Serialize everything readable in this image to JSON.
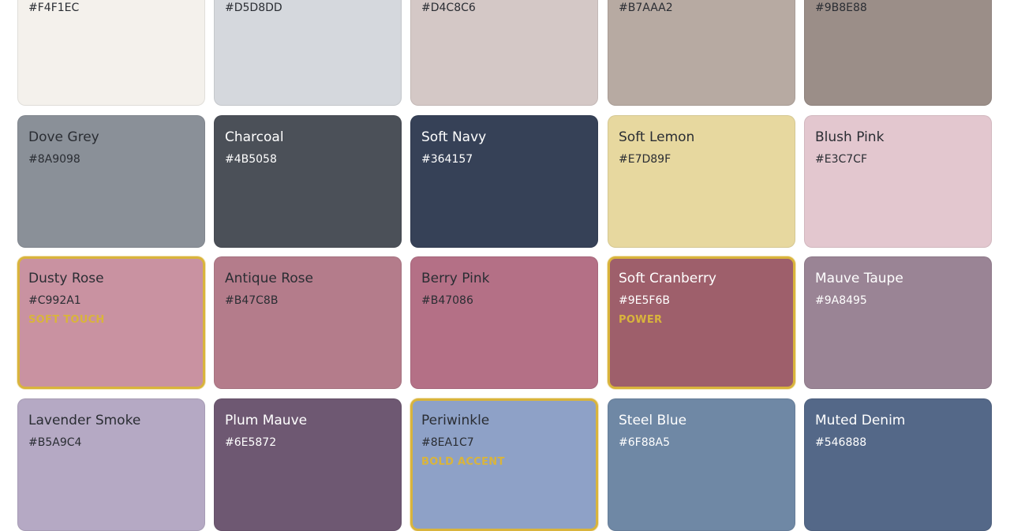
{
  "palette": {
    "accent_color": "#D9B43C",
    "swatches": [
      {
        "name": "",
        "hex": "#F4F1EC",
        "color": "#F4F1EC",
        "tone": "light",
        "tag": ""
      },
      {
        "name": "",
        "hex": "#D5D8DD",
        "color": "#D5D8DD",
        "tone": "light",
        "tag": ""
      },
      {
        "name": "",
        "hex": "#D4C8C6",
        "color": "#D4C8C6",
        "tone": "light",
        "tag": ""
      },
      {
        "name": "",
        "hex": "#B7AAA2",
        "color": "#B7AAA2",
        "tone": "light",
        "tag": ""
      },
      {
        "name": "",
        "hex": "#9B8E88",
        "color": "#9B8E88",
        "tone": "light",
        "tag": ""
      },
      {
        "name": "Dove Grey",
        "hex": "#8A9098",
        "color": "#8A9098",
        "tone": "light",
        "tag": ""
      },
      {
        "name": "Charcoal",
        "hex": "#4B5058",
        "color": "#4B5058",
        "tone": "dark",
        "tag": ""
      },
      {
        "name": "Soft Navy",
        "hex": "#364157",
        "color": "#364157",
        "tone": "dark",
        "tag": ""
      },
      {
        "name": "Soft Lemon",
        "hex": "#E7D89F",
        "color": "#E7D89F",
        "tone": "light",
        "tag": ""
      },
      {
        "name": "Blush Pink",
        "hex": "#E3C7CF",
        "color": "#E3C7CF",
        "tone": "light",
        "tag": ""
      },
      {
        "name": "Dusty Rose",
        "hex": "#C992A1",
        "color": "#C992A1",
        "tone": "light",
        "tag": "SOFT TOUCH",
        "highlight": true
      },
      {
        "name": "Antique Rose",
        "hex": "#B47C8B",
        "color": "#B47C8B",
        "tone": "light",
        "tag": ""
      },
      {
        "name": "Berry Pink",
        "hex": "#B47086",
        "color": "#B47086",
        "tone": "light",
        "tag": ""
      },
      {
        "name": "Soft Cranberry",
        "hex": "#9E5F6B",
        "color": "#9E5F6B",
        "tone": "dark",
        "tag": "POWER",
        "highlight": true
      },
      {
        "name": "Mauve Taupe",
        "hex": "#9A8495",
        "color": "#9A8495",
        "tone": "dark",
        "tag": ""
      },
      {
        "name": "Lavender Smoke",
        "hex": "#B5A9C4",
        "color": "#B5A9C4",
        "tone": "light",
        "tag": ""
      },
      {
        "name": "Plum Mauve",
        "hex": "#6E5872",
        "color": "#6E5872",
        "tone": "dark",
        "tag": ""
      },
      {
        "name": "Periwinkle",
        "hex": "#8EA1C7",
        "color": "#8EA1C7",
        "tone": "light",
        "tag": "BOLD ACCENT",
        "highlight": true
      },
      {
        "name": "Steel Blue",
        "hex": "#6F88A5",
        "color": "#6F88A5",
        "tone": "dark",
        "tag": ""
      },
      {
        "name": "Muted Denim",
        "hex": "#546888",
        "color": "#546888",
        "tone": "dark",
        "tag": ""
      }
    ]
  }
}
